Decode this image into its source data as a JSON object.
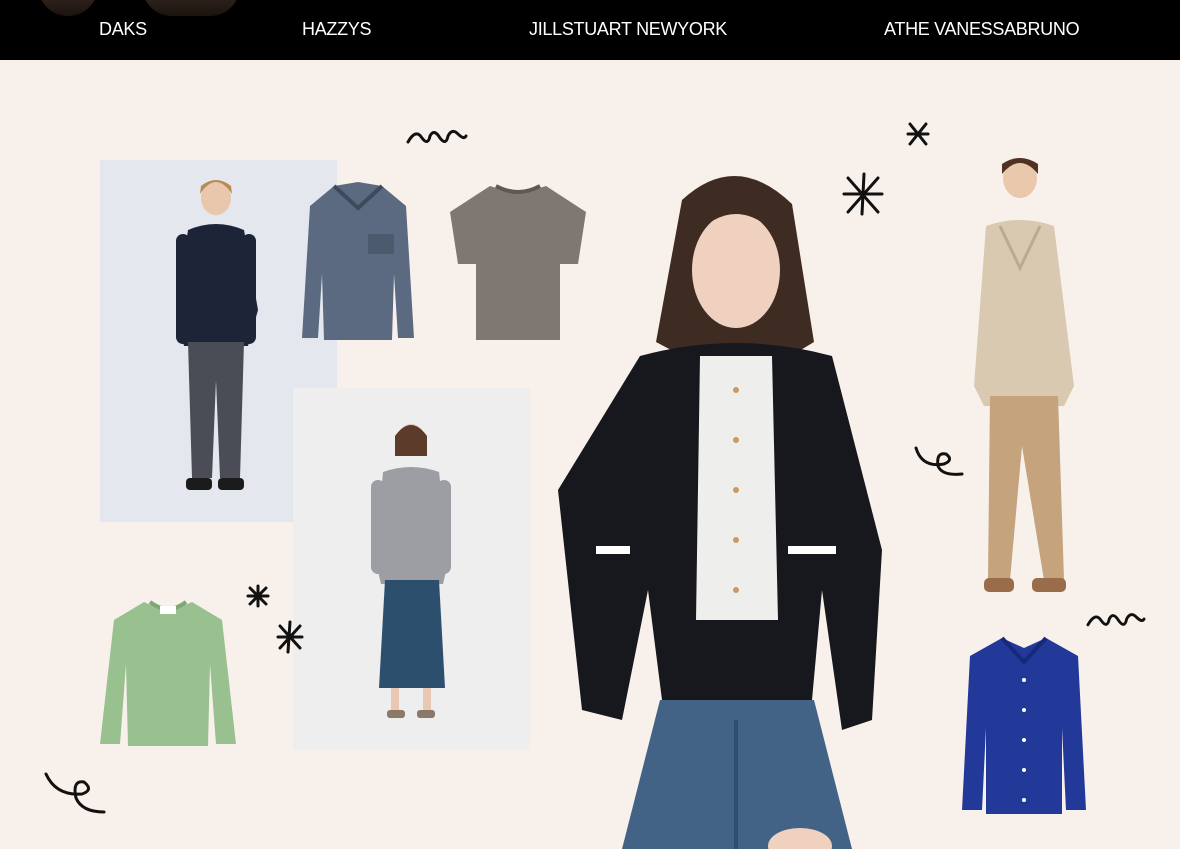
{
  "brands": [
    "DAKS",
    "HAZZYS",
    "JILLSTUART NEWYORK",
    "ATHE VANESSABRUNO"
  ],
  "colors": {
    "nav_bg": "#000000",
    "nav_text": "#ffffff",
    "page_bg": "#f8f0eb"
  },
  "collage": {
    "images": [
      "daks-man-navy-jacket",
      "denim-jacket",
      "gray-tshirt",
      "woman-gray-sweatshirt-blue-skirt",
      "mint-sweater",
      "woman-tweed-jacket-jeans",
      "man-beige-cardigan",
      "navy-shirt"
    ],
    "doodles": [
      "squiggle-icon",
      "star-icon",
      "loop-icon"
    ]
  }
}
